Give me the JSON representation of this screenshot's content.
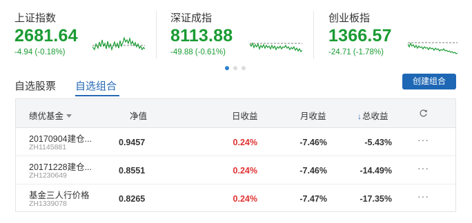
{
  "indices": [
    {
      "name": "上证指数",
      "value": "2681.64",
      "change": "-4.94 (-0.18%)",
      "color": "#1a9b33"
    },
    {
      "name": "深证成指",
      "value": "8113.88",
      "change": "-49.88 (-0.61%)",
      "color": "#1a9b33"
    },
    {
      "name": "创业板指",
      "value": "1366.57",
      "change": "-24.71 (-1.78%)",
      "color": "#1a9b33"
    }
  ],
  "pager": {
    "count": 3,
    "active": 0
  },
  "tabs": [
    {
      "label": "自选股票",
      "active": false
    },
    {
      "label": "自选组合",
      "active": true
    }
  ],
  "create_button": {
    "label": "创建组合"
  },
  "table": {
    "columns": {
      "fund": "绩优基金",
      "nav": "净值",
      "daily": "日收益",
      "monthly": "月收益",
      "total_arrow": "↓",
      "total": "总收益",
      "refresh_icon": "refresh-icon"
    },
    "rows": [
      {
        "name": "20170904建仓...",
        "code": "ZH1145881",
        "nav": "0.9457",
        "daily": "0.24%",
        "monthly": "-7.46%",
        "total": "-5.43%",
        "more": "···"
      },
      {
        "name": "20171228建仓...",
        "code": "ZH1230649",
        "nav": "0.8551",
        "daily": "0.24%",
        "monthly": "-7.46%",
        "total": "-14.49%",
        "more": "···"
      },
      {
        "name": "基金三人行价格",
        "code": "ZH1339078",
        "nav": "0.8265",
        "daily": "0.24%",
        "monthly": "-7.47%",
        "total": "-17.35%",
        "more": "···"
      }
    ]
  },
  "colors": {
    "index_down": "#1a9b33",
    "gain_red": "#e03131",
    "accent_blue": "#1e67b5",
    "header_bg": "#f4f5f7"
  }
}
